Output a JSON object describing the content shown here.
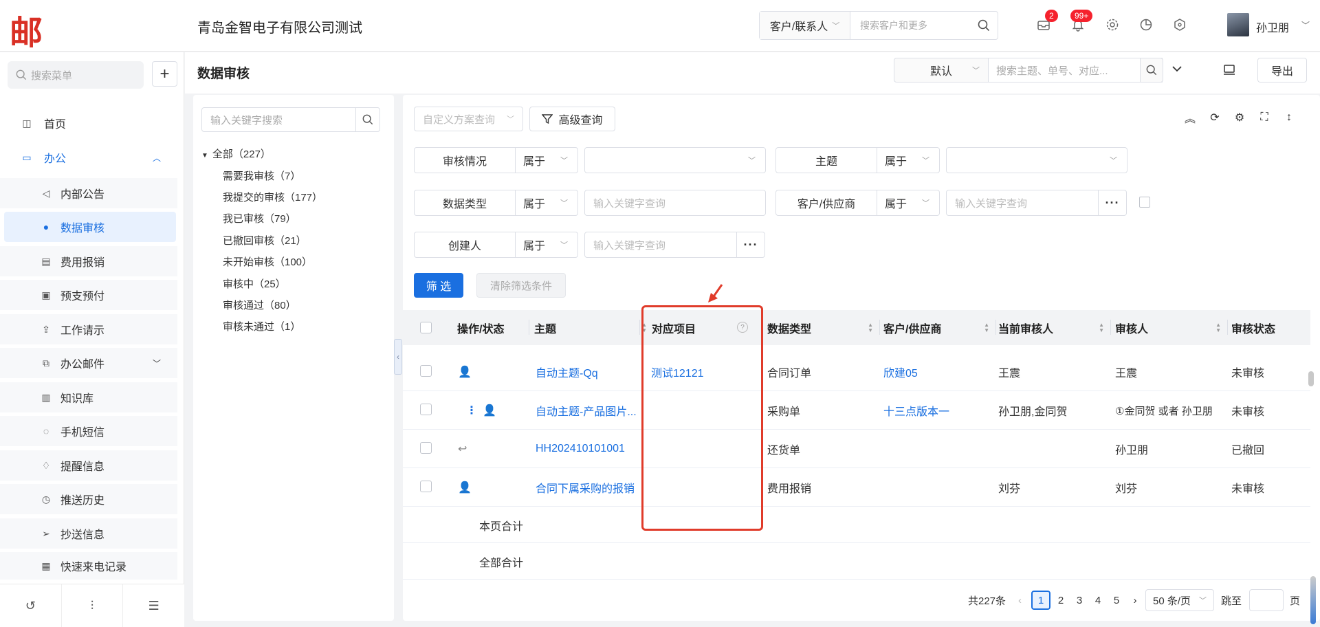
{
  "header": {
    "logo": "邮",
    "company": "青岛金智电子有限公司测试",
    "search_type": "客户/联系人",
    "search_placeholder": "搜索客户和更多",
    "badge_tasks": "2",
    "badge_notify": "99+",
    "user_name": "孙卫朋"
  },
  "sidebar": {
    "search_placeholder": "搜索菜单",
    "items": [
      {
        "label": "首页"
      },
      {
        "label": "办公"
      },
      {
        "label": "内部公告"
      },
      {
        "label": "数据审核"
      },
      {
        "label": "费用报销"
      },
      {
        "label": "预支预付"
      },
      {
        "label": "工作请示"
      },
      {
        "label": "办公邮件"
      },
      {
        "label": "知识库"
      },
      {
        "label": "手机短信"
      },
      {
        "label": "提醒信息"
      },
      {
        "label": "推送历史"
      },
      {
        "label": "抄送信息"
      },
      {
        "label": "快速来电记录"
      }
    ]
  },
  "page": {
    "title": "数据审核",
    "scheme": "默认",
    "search_placeholder": "搜索主题、单号、对应...",
    "export": "导出"
  },
  "tree": {
    "search_placeholder": "输入关键字搜索",
    "root": "全部（227）",
    "nodes": [
      "需要我审核（7）",
      "我提交的审核（177）",
      "我已审核（79）",
      "已撤回审核（21）",
      "未开始审核（100）",
      "审核中（25）",
      "审核通过（80）",
      "审核未通过（1）"
    ]
  },
  "filters": {
    "custom_query": "自定义方案查询",
    "advanced": "高级查询",
    "op": "属于",
    "keyword_placeholder": "输入关键字查询",
    "f1": "审核情况",
    "f2": "主题",
    "f3": "数据类型",
    "f4": "客户/供应商",
    "f5": "创建人",
    "filter_btn": "筛 选",
    "clear_btn": "清除筛选条件"
  },
  "table": {
    "columns": [
      "操作/状态",
      "主题",
      "对应项目",
      "数据类型",
      "客户/供应商",
      "当前审核人",
      "审核人",
      "审核状态"
    ],
    "rows": [
      {
        "subject": "自动主题-Qq",
        "project": "测试12121",
        "type": "合同订单",
        "customer": "欣建05",
        "current": "王震",
        "reviewer": "王震",
        "status": "未审核"
      },
      {
        "subject": "自动主题-产品图片...",
        "project": "",
        "type": "采购单",
        "customer": "十三点版本一",
        "current": "孙卫朋,金同贺",
        "reviewer": "①金同贺 或者 孙卫朋",
        "status": "未审核"
      },
      {
        "subject": "HH202410101001",
        "project": "",
        "type": "还货单",
        "customer": "",
        "current": "",
        "reviewer": "孙卫朋",
        "status": "已撤回"
      },
      {
        "subject": "合同下属采购的报销",
        "project": "",
        "type": "费用报销",
        "customer": "",
        "current": "刘芬",
        "reviewer": "刘芬",
        "status": "未审核"
      }
    ],
    "page_total": "本页合计",
    "all_total": "全部合计"
  },
  "pager": {
    "total": "共227条",
    "pages": [
      "1",
      "2",
      "3",
      "4",
      "5"
    ],
    "size": "50 条/页",
    "jump": "跳至",
    "page_unit": "页"
  }
}
